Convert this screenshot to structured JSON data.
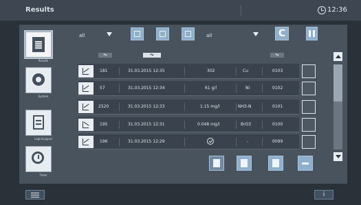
{
  "header": {
    "title": "Results",
    "time": "12:36"
  },
  "sidebar": {
    "items": [
      {
        "label": "Results",
        "icon": "results-icon",
        "active": true
      },
      {
        "label": "System",
        "icon": "system-icon",
        "active": false
      },
      {
        "label": "Login/Logout",
        "icon": "login-logout-icon",
        "active": false
      },
      {
        "label": "Timer",
        "icon": "timer-icon",
        "active": false
      }
    ]
  },
  "toolbar": {
    "filter1": "all",
    "filter2": "all",
    "clear_label": "C",
    "icons": [
      "filter-sample-icon",
      "filter-date-icon",
      "filter-center-icon",
      "columns-icon"
    ]
  },
  "table": {
    "rows": [
      {
        "col1": "181",
        "datetime": "31.03.2015 12:35",
        "value": "302",
        "param": "Cu",
        "id": "0103",
        "icon": "chart-icon"
      },
      {
        "col1": "57",
        "datetime": "31.03.2015 12:34",
        "value": "61 g/l",
        "param": "Ni",
        "id": "0102",
        "icon": "chart-icon"
      },
      {
        "col1": "2520",
        "datetime": "31.03.2015 12:33",
        "value": "1.15 mg/l",
        "param": "NH3-N",
        "id": "0101",
        "icon": "chart-icon"
      },
      {
        "col1": "195",
        "datetime": "31.03.2015 12:31",
        "value": "0.048 mg/l",
        "param": "BrO3",
        "id": "0100",
        "icon": "chart-icon"
      },
      {
        "col1": "196",
        "datetime": "31.03.2015 12:29",
        "value": "",
        "param": "-",
        "id": "0099",
        "icon": "sample-icon"
      }
    ]
  },
  "actions": [
    "delete-icon",
    "print-icon",
    "export-icon",
    "minus-icon"
  ],
  "footer": {
    "info_label": "i"
  },
  "colors": {
    "accent": "#8fb0cd",
    "panel": "#49535e",
    "title_bar": "#3d4651"
  }
}
